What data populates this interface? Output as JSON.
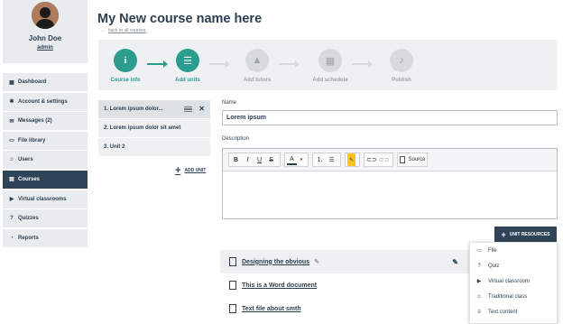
{
  "profile": {
    "name": "John Doe",
    "role": "admin"
  },
  "nav": [
    {
      "label": "Dashboard",
      "icon": "dashboard-icon",
      "glyph": "▦",
      "active": false
    },
    {
      "label": "Account & settings",
      "icon": "gear-icon",
      "glyph": "✱",
      "active": false
    },
    {
      "label": "Messages (2)",
      "icon": "envelope-icon",
      "glyph": "✉",
      "active": false
    },
    {
      "label": "File library",
      "icon": "file-icon",
      "glyph": "▭",
      "active": false
    },
    {
      "label": "Users",
      "icon": "users-icon",
      "glyph": "☺",
      "active": false
    },
    {
      "label": "Courses",
      "icon": "courses-icon",
      "glyph": "▤",
      "active": true
    },
    {
      "label": "Virtual classrooms",
      "icon": "video-icon",
      "glyph": "▶",
      "active": false
    },
    {
      "label": "Quizzes",
      "icon": "question-icon",
      "glyph": "?",
      "active": false
    },
    {
      "label": "Reports",
      "icon": "chart-icon",
      "glyph": "◔",
      "active": false
    }
  ],
  "header": {
    "title": "My New course name here",
    "back": "back to all courses"
  },
  "steps": [
    {
      "label": "Course info",
      "icon": "info-icon",
      "glyph": "i",
      "done": true
    },
    {
      "label": "Add units",
      "icon": "list-icon",
      "glyph": "☰",
      "done": true
    },
    {
      "label": "Add tutors",
      "icon": "graduation-cap-icon",
      "glyph": "▲",
      "done": false
    },
    {
      "label": "Add schedule",
      "icon": "calendar-icon",
      "glyph": "▦",
      "done": false
    },
    {
      "label": "Publish",
      "icon": "bell-icon",
      "glyph": "♪",
      "done": false
    }
  ],
  "units": [
    {
      "label": "1. Lorem ipsum dolor...",
      "active": true
    },
    {
      "label": "2. Lorem ipsum dolor sit amet",
      "active": false
    },
    {
      "label": "3. Unit 2",
      "active": false
    }
  ],
  "add_unit": "ADD UNIT",
  "form": {
    "name_label": "Name",
    "name_value": "Lorem ipsum",
    "description_label": "Description",
    "source_label": "Source"
  },
  "unit_resources": {
    "button": "UNIT RESOURCES",
    "menu": [
      {
        "label": "File",
        "icon": "file-icon",
        "glyph": "▭"
      },
      {
        "label": "Quiz",
        "icon": "question-icon",
        "glyph": "?"
      },
      {
        "label": "Virtual classroom",
        "icon": "video-icon",
        "glyph": "▶"
      },
      {
        "label": "Traditional class",
        "icon": "users-icon",
        "glyph": "☺"
      },
      {
        "label": "Text content",
        "icon": "text-icon",
        "glyph": "≡"
      }
    ]
  },
  "resources": [
    {
      "name": "Designing the obvious",
      "type": "pdf-icon",
      "highlight": true
    },
    {
      "name": "This is a Word document",
      "type": "word-icon",
      "highlight": false
    },
    {
      "name": "Text file about smth",
      "type": "text-file-icon",
      "highlight": false
    }
  ],
  "colors": {
    "accent": "#2a9d8f",
    "dark": "#2f4456",
    "panel": "#eef0f2"
  }
}
